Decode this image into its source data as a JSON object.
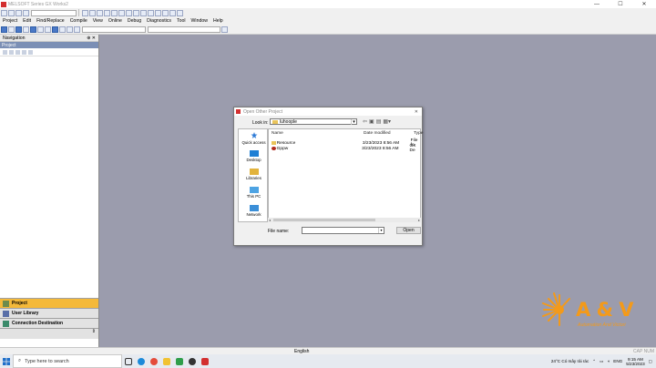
{
  "window": {
    "title": "MELSOFT Series GX Works2",
    "controls": [
      "—",
      "☐",
      "✕"
    ]
  },
  "menu": [
    "Project",
    "Edit",
    "Find/Replace",
    "Compile",
    "View",
    "Online",
    "Debug",
    "Diagnostics",
    "Tool",
    "Window",
    "Help"
  ],
  "navigation": {
    "title": "Navigation",
    "pin_glyphs": "⊕ ✕",
    "section": "Project",
    "tabs": [
      {
        "label": "Project",
        "active": true
      },
      {
        "label": "User Library",
        "active": false
      },
      {
        "label": "Connection Destination",
        "active": false
      }
    ]
  },
  "dialog": {
    "title": "Open Other Project",
    "close": "✕",
    "look_in_label": "Look in:",
    "look_in_value": "luhoople",
    "places": [
      "Quick access",
      "Desktop",
      "Libraries",
      "This PC",
      "Network"
    ],
    "columns": [
      "Name",
      "Date modified",
      "Type"
    ],
    "files": [
      {
        "name": "Resource",
        "date": "3/23/2023 8:56 AM",
        "type": "File fo"
      },
      {
        "name": "Gppw",
        "date": "3/23/2023 8:56 AM",
        "type": "GX De"
      }
    ],
    "file_name_label": "File name:",
    "file_name_value": "",
    "open_label": "Open",
    "scroll_left": "◂",
    "scroll_right": "▸",
    "combo_arrow": "▾"
  },
  "statusbar": {
    "language": "English",
    "caps": "CAP   NUM"
  },
  "taskbar": {
    "search_placeholder": "Type here to search",
    "weather": "24°C  Có mây rải rác",
    "tray_lang": "ENG",
    "time": "9:15 AM",
    "date": "5/23/2023"
  },
  "logo": {
    "brand": "A & V",
    "tagline": "Automation And Victori"
  },
  "colors": {
    "accent_orange": "#f39a1a",
    "nav_active": "#f4b93a",
    "workspace": "#9b9cad"
  }
}
